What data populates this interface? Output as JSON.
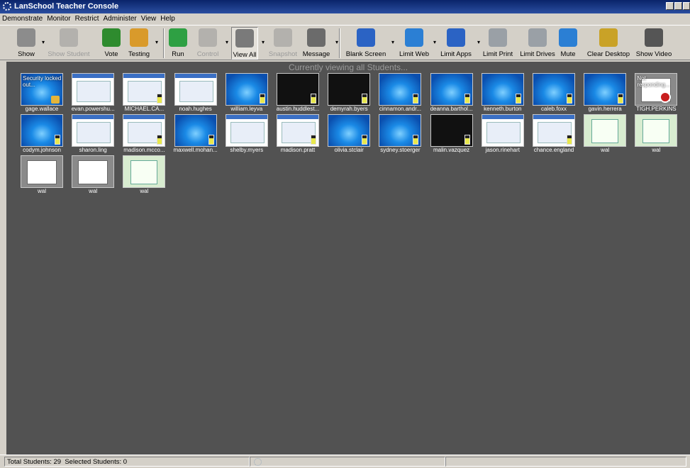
{
  "window": {
    "title": "LanSchool Teacher Console"
  },
  "menu": [
    "Demonstrate",
    "Monitor",
    "Restrict",
    "Administer",
    "View",
    "Help"
  ],
  "toolbar": [
    {
      "label": "Show",
      "icon": "show-icon",
      "color": "#8c8c8c",
      "disabled": false
    },
    {
      "label": "Show Student",
      "icon": "show-student-icon",
      "color": "#8c8c8c",
      "disabled": true
    },
    {
      "label": "Vote",
      "icon": "vote-icon",
      "color": "#2e8b2e",
      "disabled": false
    },
    {
      "label": "Testing",
      "icon": "testing-icon",
      "color": "#d99a2b",
      "disabled": false
    },
    {
      "label": "Run",
      "icon": "run-icon",
      "color": "#2ea043",
      "disabled": false
    },
    {
      "label": "Control",
      "icon": "control-icon",
      "color": "#8c8c8c",
      "disabled": true
    },
    {
      "label": "View All",
      "icon": "view-all-icon",
      "color": "#7a7a7a",
      "disabled": false,
      "pressed": true
    },
    {
      "label": "Snapshot",
      "icon": "snapshot-icon",
      "color": "#8c8c8c",
      "disabled": true
    },
    {
      "label": "Message",
      "icon": "message-icon",
      "color": "#6b6b6b",
      "disabled": false
    },
    {
      "label": "Blank Screen",
      "icon": "blank-screen-icon",
      "color": "#2b63c4",
      "disabled": false
    },
    {
      "label": "Limit Web",
      "icon": "limit-web-icon",
      "color": "#2b7fd4",
      "disabled": false
    },
    {
      "label": "Limit Apps",
      "icon": "limit-apps-icon",
      "color": "#2b63c4",
      "disabled": false
    },
    {
      "label": "Limit Print",
      "icon": "limit-print-icon",
      "color": "#9aa0a6",
      "disabled": false
    },
    {
      "label": "Limit Drives",
      "icon": "limit-drives-icon",
      "color": "#9aa0a6",
      "disabled": false
    },
    {
      "label": "Mute",
      "icon": "mute-icon",
      "color": "#2b7fd4",
      "disabled": false
    },
    {
      "label": "Clear Desktop",
      "icon": "clear-desktop-icon",
      "color": "#c9a227",
      "disabled": false
    },
    {
      "label": "Show Video",
      "icon": "show-video-icon",
      "color": "#555555",
      "disabled": false
    }
  ],
  "main": {
    "viewing_label": "Currently viewing all Students..."
  },
  "students": [
    {
      "name": "gage.wallace",
      "screen": "win7",
      "overlay": "Security locked out...",
      "badge": "lock"
    },
    {
      "name": "evan.powershu...",
      "screen": "web",
      "badge": ""
    },
    {
      "name": "MICHAEL.CA...",
      "screen": "web",
      "badge": "battery"
    },
    {
      "name": "noah.hughes",
      "screen": "web",
      "badge": ""
    },
    {
      "name": "william.leyva",
      "screen": "win7",
      "badge": "battery"
    },
    {
      "name": "austin.huddlest...",
      "screen": "black",
      "badge": "battery"
    },
    {
      "name": "demyrah.byers",
      "screen": "black",
      "badge": "battery"
    },
    {
      "name": "cinnamon.andr...",
      "screen": "win7",
      "badge": "battery"
    },
    {
      "name": "deanna.barthol...",
      "screen": "win7",
      "badge": "battery"
    },
    {
      "name": "kenneth.burton",
      "screen": "win7",
      "badge": "battery"
    },
    {
      "name": "caleb.foxx",
      "screen": "win7",
      "badge": "battery"
    },
    {
      "name": "gavin.herrera",
      "screen": "win7",
      "badge": "battery"
    },
    {
      "name": "TIGH.PERKINS",
      "screen": "gray",
      "overlay": "Not responding...",
      "badge": "stop"
    },
    {
      "name": "codym.johnson",
      "screen": "win7",
      "badge": "battery"
    },
    {
      "name": "sharon.ling",
      "screen": "web",
      "badge": ""
    },
    {
      "name": "madison.mcco...",
      "screen": "web",
      "badge": "battery"
    },
    {
      "name": "maxwell.mohan...",
      "screen": "win7",
      "badge": "battery"
    },
    {
      "name": "shelby.myers",
      "screen": "web",
      "badge": ""
    },
    {
      "name": "madison.pratt",
      "screen": "web",
      "badge": "battery"
    },
    {
      "name": "olivia.stclair",
      "screen": "win7",
      "badge": "battery"
    },
    {
      "name": "sydney.stoerger",
      "screen": "win7",
      "badge": "battery"
    },
    {
      "name": "malin.vazquez",
      "screen": "black",
      "badge": "battery"
    },
    {
      "name": "jason.rinehart",
      "screen": "web",
      "badge": ""
    },
    {
      "name": "chance.england",
      "screen": "web",
      "badge": "battery"
    },
    {
      "name": "wal",
      "screen": "green",
      "badge": ""
    },
    {
      "name": "wal",
      "screen": "green",
      "badge": ""
    },
    {
      "name": "wal",
      "screen": "gray",
      "badge": ""
    },
    {
      "name": "wal",
      "screen": "gray",
      "badge": ""
    },
    {
      "name": "wal",
      "screen": "green",
      "badge": ""
    }
  ],
  "status": {
    "total": "Total Students: 29",
    "selected": "Selected Students: 0"
  }
}
